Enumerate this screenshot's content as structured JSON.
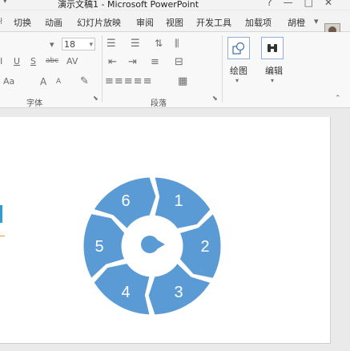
{
  "window": {
    "title": "演示文稿1 - Microsoft PowerPoint",
    "controls": [
      "?",
      "—",
      "□",
      "✕"
    ]
  },
  "tabs": [
    "切换",
    "动画",
    "幻灯片放映",
    "审阅",
    "视图",
    "开发工具",
    "加载项",
    "胡橙"
  ],
  "ribbon": {
    "font_size_value": "18",
    "font_buttons": [
      "U",
      "S",
      "abc",
      "AV"
    ],
    "text_size_buttons": [
      "Aa",
      "A",
      "A"
    ],
    "draw_label": "绘图",
    "edit_label": "编辑",
    "group_font": "字体",
    "group_paragraph": "段落"
  },
  "diagram": {
    "segments": [
      "1",
      "2",
      "3",
      "4",
      "5",
      "6"
    ],
    "color": "#5b9bd5"
  }
}
